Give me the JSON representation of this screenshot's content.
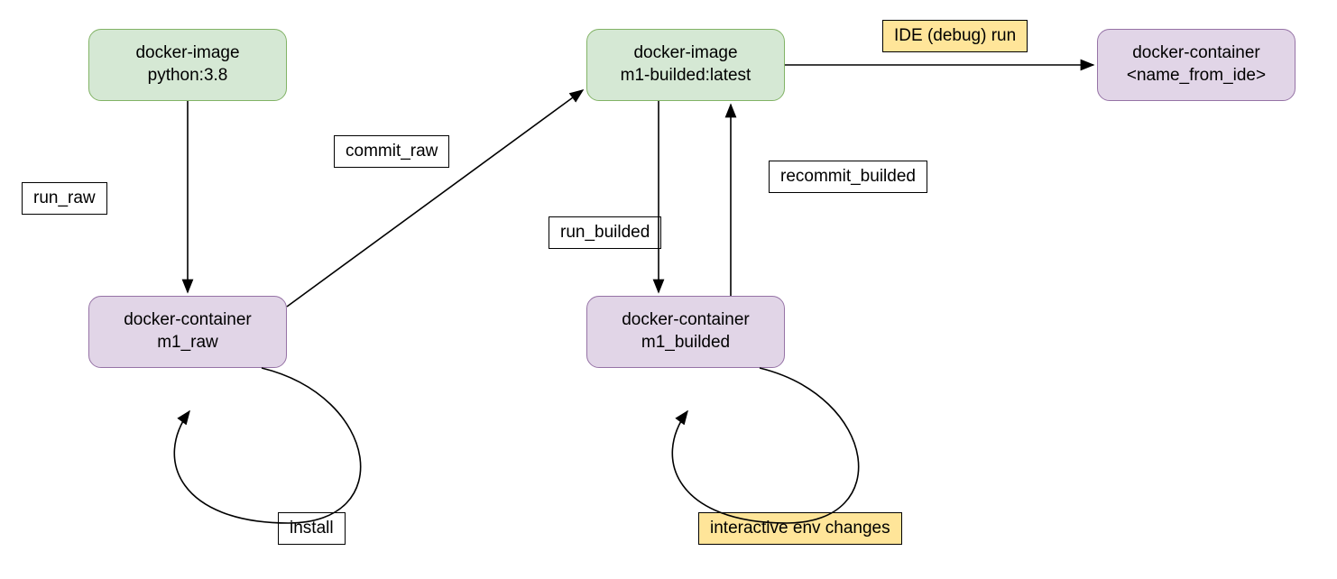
{
  "nodes": {
    "img_python": {
      "line1": "docker-image",
      "line2": "python:3.8"
    },
    "img_builded": {
      "line1": "docker-image",
      "line2": "m1-builded:latest"
    },
    "cont_ide": {
      "line1": "docker-container",
      "line2": "<name_from_ide>"
    },
    "cont_raw": {
      "line1": "docker-container",
      "line2": "m1_raw"
    },
    "cont_builded": {
      "line1": "docker-container",
      "line2": "m1_builded"
    }
  },
  "labels": {
    "run_raw": "run_raw",
    "commit_raw": "commit_raw",
    "run_builded": "run_builded",
    "recommit_builded": "recommit_builded",
    "ide_run": "IDE (debug) run",
    "install": "install",
    "interactive": "interactive env changes"
  }
}
